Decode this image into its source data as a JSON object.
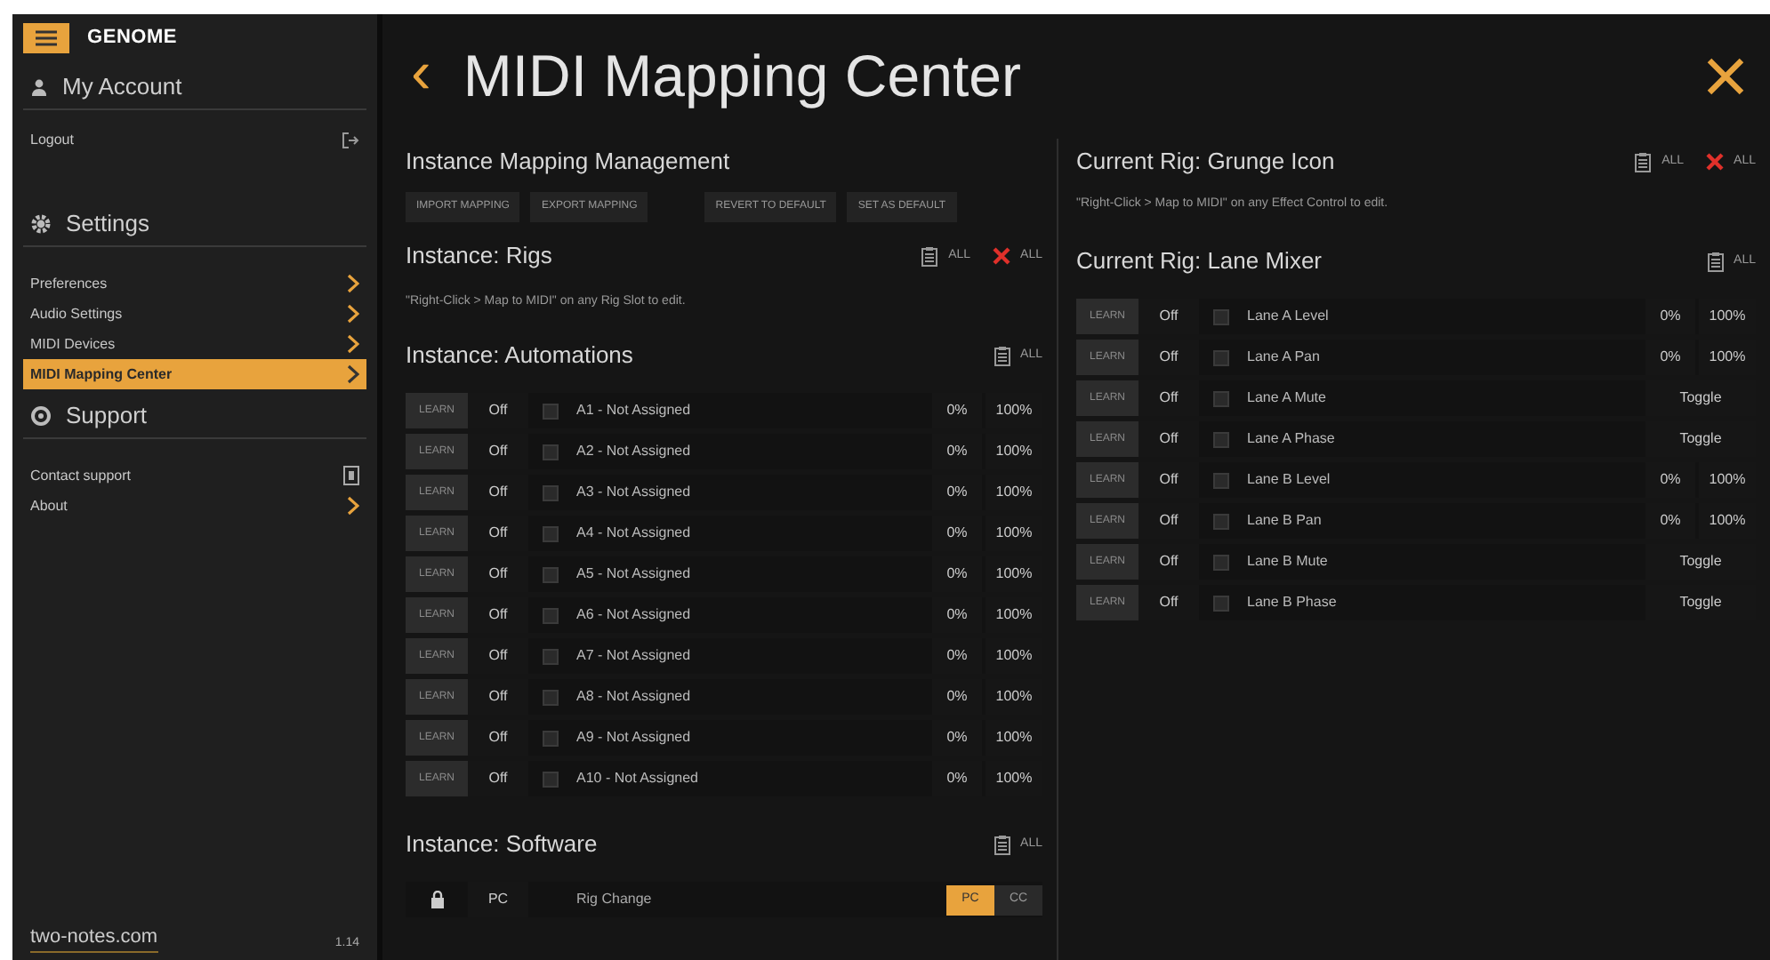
{
  "brand": "GENOME",
  "sidebar": {
    "sections": [
      {
        "title": "My Account",
        "kind": "account",
        "items": [
          {
            "label": "Logout",
            "kind": "logout",
            "selected": false
          }
        ]
      },
      {
        "title": "Settings",
        "kind": "settings",
        "items": [
          {
            "label": "Preferences",
            "kind": "chevron",
            "selected": false
          },
          {
            "label": "Audio Settings",
            "kind": "chevron",
            "selected": false
          },
          {
            "label": "MIDI Devices",
            "kind": "chevron",
            "selected": false
          },
          {
            "label": "MIDI Mapping Center",
            "kind": "chevron",
            "selected": true
          }
        ]
      },
      {
        "title": "Support",
        "kind": "support",
        "items": [
          {
            "label": "Contact support",
            "kind": "external",
            "selected": false
          },
          {
            "label": "About",
            "kind": "chevron",
            "selected": false
          }
        ]
      }
    ],
    "footer_link": "two-notes.com",
    "version": "1.14"
  },
  "page": {
    "back": "‹",
    "title": "MIDI Mapping Center"
  },
  "management": {
    "title": "Instance Mapping Management",
    "buttons": [
      "IMPORT MAPPING",
      "EXPORT MAPPING",
      "REVERT TO DEFAULT",
      "SET AS DEFAULT"
    ]
  },
  "rigs": {
    "title": "Instance: Rigs",
    "actions": [
      {
        "kind": "clear",
        "label": "ALL"
      },
      {
        "kind": "delete",
        "label": "ALL"
      }
    ],
    "hint": "\"Right-Click > Map to MIDI\" on any Rig Slot to edit."
  },
  "automations": {
    "title": "Instance: Automations",
    "actions": [
      {
        "kind": "clear",
        "label": "ALL"
      }
    ],
    "rows": [
      {
        "learn": "LEARN",
        "cc": "Off",
        "checked": false,
        "name": "A1 - Not Assigned",
        "kind": "range",
        "min": "0%",
        "max": "100%"
      },
      {
        "learn": "LEARN",
        "cc": "Off",
        "checked": false,
        "name": "A2 - Not Assigned",
        "kind": "range",
        "min": "0%",
        "max": "100%"
      },
      {
        "learn": "LEARN",
        "cc": "Off",
        "checked": false,
        "name": "A3 - Not Assigned",
        "kind": "range",
        "min": "0%",
        "max": "100%"
      },
      {
        "learn": "LEARN",
        "cc": "Off",
        "checked": false,
        "name": "A4 - Not Assigned",
        "kind": "range",
        "min": "0%",
        "max": "100%"
      },
      {
        "learn": "LEARN",
        "cc": "Off",
        "checked": false,
        "name": "A5 - Not Assigned",
        "kind": "range",
        "min": "0%",
        "max": "100%"
      },
      {
        "learn": "LEARN",
        "cc": "Off",
        "checked": false,
        "name": "A6 - Not Assigned",
        "kind": "range",
        "min": "0%",
        "max": "100%"
      },
      {
        "learn": "LEARN",
        "cc": "Off",
        "checked": false,
        "name": "A7 - Not Assigned",
        "kind": "range",
        "min": "0%",
        "max": "100%"
      },
      {
        "learn": "LEARN",
        "cc": "Off",
        "checked": false,
        "name": "A8 - Not Assigned",
        "kind": "range",
        "min": "0%",
        "max": "100%"
      },
      {
        "learn": "LEARN",
        "cc": "Off",
        "checked": false,
        "name": "A9 - Not Assigned",
        "kind": "range",
        "min": "0%",
        "max": "100%"
      },
      {
        "learn": "LEARN",
        "cc": "Off",
        "checked": false,
        "name": "A10 - Not Assigned",
        "kind": "range",
        "min": "0%",
        "max": "100%"
      }
    ]
  },
  "software": {
    "title": "Instance: Software",
    "actions": [
      {
        "kind": "clear",
        "label": "ALL"
      }
    ],
    "rows": [
      {
        "type": "PC",
        "name": "Rig Change",
        "options": [
          {
            "label": "PC",
            "selected": true
          },
          {
            "label": "CC",
            "selected": false
          }
        ]
      }
    ]
  },
  "current_rig": {
    "title": "Current Rig: Grunge Icon",
    "actions": [
      {
        "kind": "clear",
        "label": "ALL"
      },
      {
        "kind": "delete",
        "label": "ALL"
      }
    ],
    "hint": "\"Right-Click > Map to MIDI\" on any Effect Control to edit."
  },
  "lane_mixer": {
    "title": "Current Rig: Lane Mixer",
    "actions": [
      {
        "kind": "clear",
        "label": "ALL"
      }
    ],
    "rows": [
      {
        "learn": "LEARN",
        "cc": "Off",
        "checked": false,
        "name": "Lane A Level",
        "kind": "range",
        "min": "0%",
        "max": "100%"
      },
      {
        "learn": "LEARN",
        "cc": "Off",
        "checked": false,
        "name": "Lane A Pan",
        "kind": "range",
        "min": "0%",
        "max": "100%"
      },
      {
        "learn": "LEARN",
        "cc": "Off",
        "checked": false,
        "name": "Lane A Mute",
        "kind": "toggle",
        "mode": "Toggle"
      },
      {
        "learn": "LEARN",
        "cc": "Off",
        "checked": false,
        "name": "Lane A Phase",
        "kind": "toggle",
        "mode": "Toggle"
      },
      {
        "learn": "LEARN",
        "cc": "Off",
        "checked": false,
        "name": "Lane B Level",
        "kind": "range",
        "min": "0%",
        "max": "100%"
      },
      {
        "learn": "LEARN",
        "cc": "Off",
        "checked": false,
        "name": "Lane B Pan",
        "kind": "range",
        "min": "0%",
        "max": "100%"
      },
      {
        "learn": "LEARN",
        "cc": "Off",
        "checked": false,
        "name": "Lane B Mute",
        "kind": "toggle",
        "mode": "Toggle"
      },
      {
        "learn": "LEARN",
        "cc": "Off",
        "checked": false,
        "name": "Lane B Phase",
        "kind": "toggle",
        "mode": "Toggle"
      }
    ]
  }
}
